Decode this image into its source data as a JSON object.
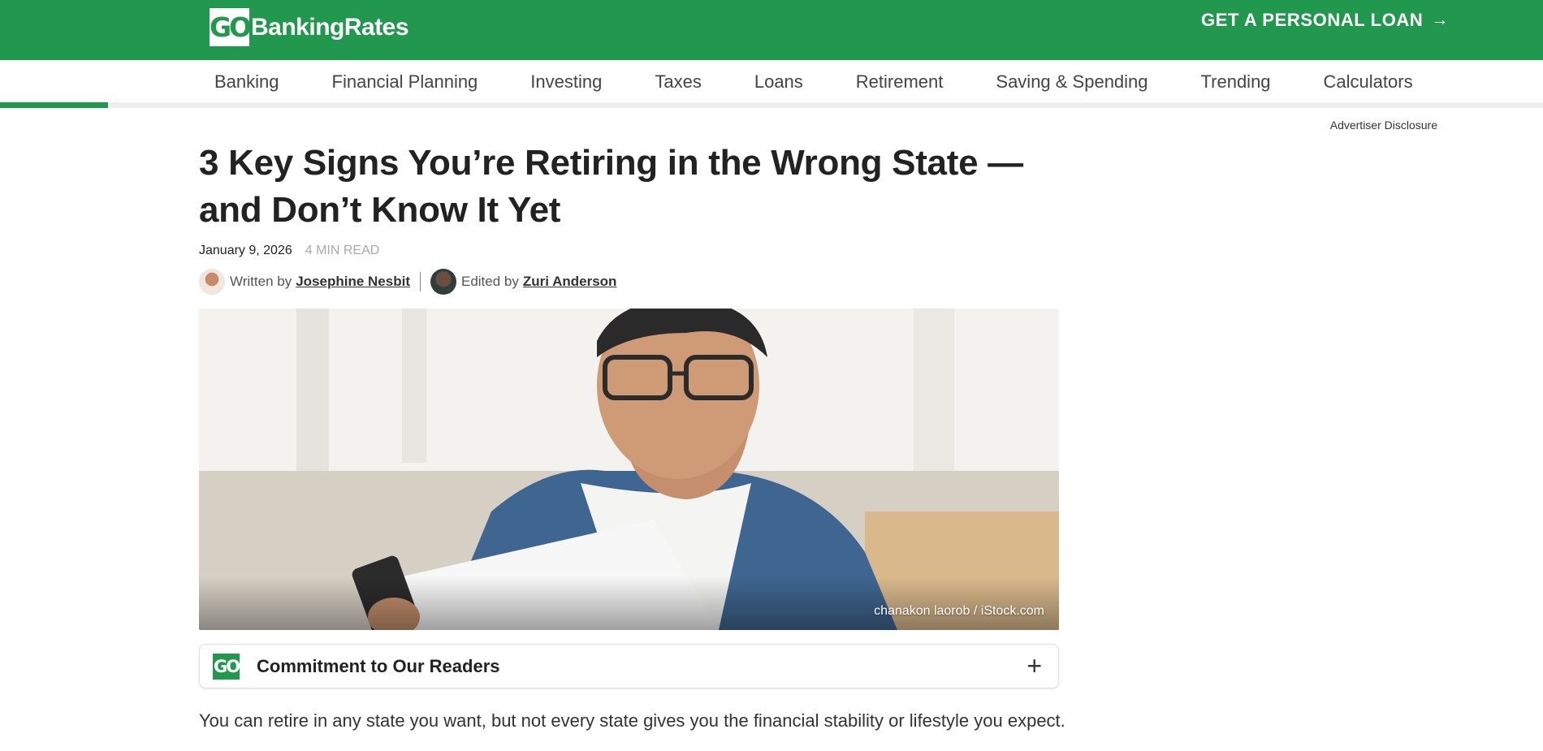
{
  "header": {
    "logo_mark": "GO",
    "logo_text": "BankingRates",
    "cta_label": "GET A PERSONAL LOAN",
    "cta_icon": "arrow-right-icon",
    "brand_color": "#21984d"
  },
  "nav": {
    "items": [
      {
        "label": "Banking"
      },
      {
        "label": "Financial Planning"
      },
      {
        "label": "Investing"
      },
      {
        "label": "Taxes"
      },
      {
        "label": "Loans"
      },
      {
        "label": "Retirement"
      },
      {
        "label": "Saving & Spending"
      },
      {
        "label": "Trending"
      },
      {
        "label": "Calculators"
      }
    ],
    "reading_progress": 0.07
  },
  "disclosure": "Advertiser Disclosure",
  "article": {
    "title": "3 Key Signs You’re Retiring in the Wrong State — and Don’t Know It Yet",
    "date": "January 9, 2026",
    "read_time": "4 MIN READ",
    "written_label": "Written by",
    "author": "Josephine Nesbit",
    "edited_label": "Edited by",
    "editor": "Zuri Anderson",
    "image_credit": "chanakon laorob / iStock.com",
    "commitment_logo": "GO",
    "commitment_title": "Commitment to Our Readers",
    "commitment_toggle": "+",
    "body": "You can retire in any state you want, but not every state gives you the financial stability or lifestyle you expect."
  }
}
